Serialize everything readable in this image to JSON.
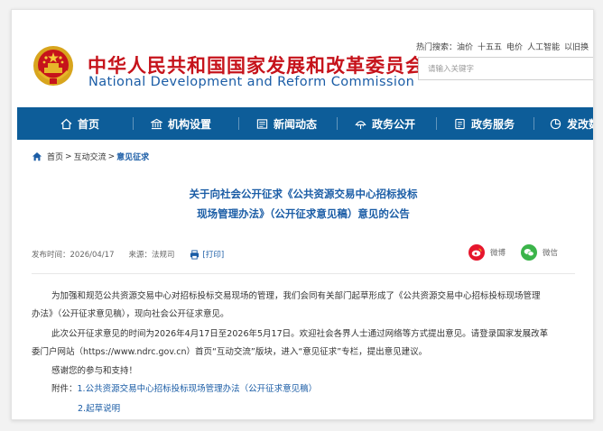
{
  "header": {
    "org_cn": "中华人民共和国国家发展和改革委员会",
    "org_en": "National Development and Reform Commission",
    "hot_label": "热门搜索：",
    "hot_items": [
      "油价",
      "十五五",
      "电价",
      "人工智能",
      "以旧换"
    ],
    "search_placeholder": "请输入关键字"
  },
  "nav": {
    "items": [
      {
        "label": "首页",
        "icon": "home-icon"
      },
      {
        "label": "机构设置",
        "icon": "institution-icon"
      },
      {
        "label": "新闻动态",
        "icon": "news-icon"
      },
      {
        "label": "政务公开",
        "icon": "gov-open-icon"
      },
      {
        "label": "政务服务",
        "icon": "gov-service-icon"
      },
      {
        "label": "发改数",
        "icon": "data-icon"
      }
    ]
  },
  "breadcrumb": {
    "home": "首页",
    "sep1": " > ",
    "level2": "互动交流",
    "sep2": " > ",
    "current": "意见征求"
  },
  "article": {
    "title_line1": "关于向社会公开征求《公共资源交易中心招标投标",
    "title_line2": "现场管理办法》（公开征求意见稿）意见的公告",
    "published": "发布时间：2026/04/17",
    "source": "来源：法规司",
    "print": "[打印]",
    "share_weibo": "微博",
    "share_wechat": "微信",
    "para1_line1": "为加强和规范公共资源交易中心对招标投标交易现场的管理，我们会同有关部门起草形成了《公共资源交易中心招标投标现场管理",
    "para1_line2": "办法》（公开征求意见稿），现向社会公开征求意见。",
    "para2_line1": "此次公开征求意见的时间为2026年4月17日至2026年5月17日。欢迎社会各界人士通过网络等方式提出意见。请登录国家发展改革",
    "para2_line2": "委门户网站（https://www.ndrc.gov.cn）首页“互动交流”版块，进入“意见征求”专栏，提出意见建议。",
    "thanks": "感谢您的参与和支持！",
    "attach_label": "附件：",
    "attach1": "1.公共资源交易中心招标投标现场管理办法（公开征求意见稿）",
    "attach2": "2.起草说明"
  },
  "colors": {
    "brand_red": "#c6131b",
    "brand_blue": "#1b5da6",
    "nav_bg": "#0d5d99"
  }
}
